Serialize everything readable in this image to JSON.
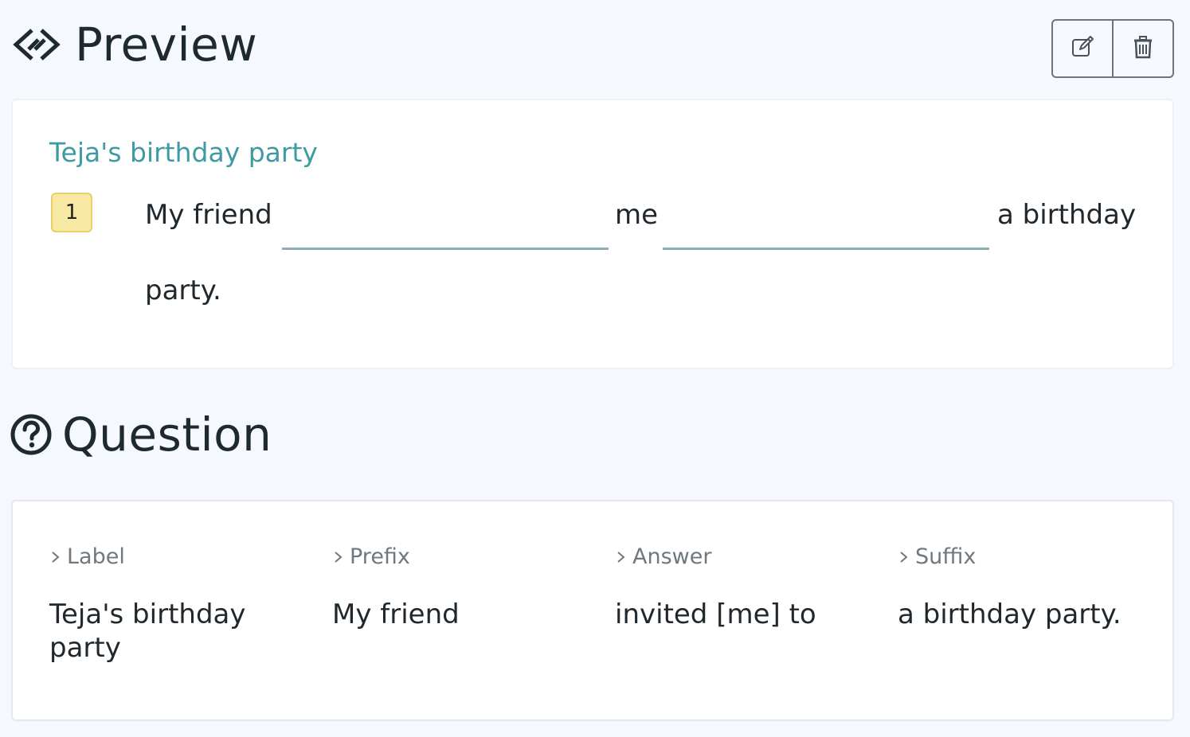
{
  "preview": {
    "title": "Preview",
    "icon": "diamond-link-icon",
    "actions": {
      "edit_icon": "edit-icon",
      "delete_icon": "trash-icon"
    },
    "card": {
      "label": "Teja's birthday party",
      "number": "1",
      "prefix": "My friend",
      "middle": "me",
      "suffix_line1": "a birthday",
      "suffix_line2": "party.",
      "blank1_value": "",
      "blank2_value": ""
    }
  },
  "question": {
    "title": "Question",
    "icon": "question-circle-icon",
    "columns": [
      {
        "heading": "Label",
        "value": "Teja's birthday party"
      },
      {
        "heading": "Prefix",
        "value": "My friend"
      },
      {
        "heading": "Answer",
        "value": "invited [me] to"
      },
      {
        "heading": "Suffix",
        "value": "a birthday party."
      }
    ]
  },
  "colors": {
    "background": "#f5f9fd",
    "label_accent": "#3e9aa3",
    "badge_fill": "#f7e8a3",
    "badge_border": "#e9cf6a",
    "blank_underline": "#8fb0b2"
  }
}
